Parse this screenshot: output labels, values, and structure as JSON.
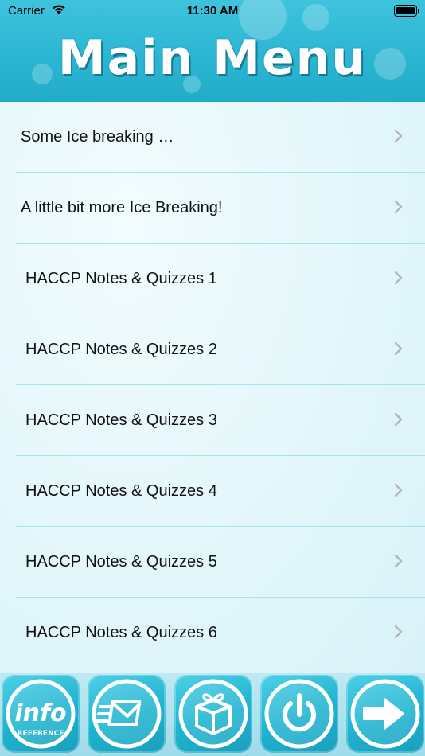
{
  "status_bar": {
    "carrier": "Carrier",
    "time": "11:30 AM"
  },
  "header": {
    "title": "Main Menu"
  },
  "menu": {
    "items": [
      {
        "label": "Some Ice breaking …"
      },
      {
        "label": "A little bit more Ice Breaking!"
      },
      {
        "label": "HACCP Notes & Quizzes 1"
      },
      {
        "label": "HACCP Notes & Quizzes 2"
      },
      {
        "label": "HACCP Notes & Quizzes 3"
      },
      {
        "label": "HACCP Notes & Quizzes 4"
      },
      {
        "label": "HACCP Notes & Quizzes 5"
      },
      {
        "label": "HACCP Notes & Quizzes 6"
      }
    ]
  },
  "toolbar": {
    "info_button": {
      "main": "info",
      "sub": "REFERENCE"
    },
    "icons": [
      "info-reference-icon",
      "mail-icon",
      "gift-icon",
      "power-icon",
      "arrow-right-icon"
    ]
  },
  "colors": {
    "header": "#2bb6d3",
    "button": "#1db3d0",
    "separator": "#a9e2ee",
    "chevron": "#b5b5b5"
  }
}
